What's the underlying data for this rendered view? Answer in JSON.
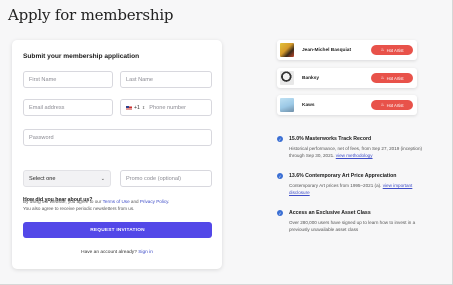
{
  "page_title": "Apply for membership",
  "form": {
    "title": "Submit your membership application",
    "first_name_placeholder": "First Name",
    "last_name_placeholder": "Last Name",
    "email_placeholder": "Email address",
    "phone_country_code": "+1",
    "phone_placeholder": "Phone number",
    "password_placeholder": "Password",
    "referral_question": "How did you hear about us?",
    "referral_selected": "Select one",
    "promo_placeholder": "Promo code (optional)",
    "legal_prefix": "By using our website, you agree to our ",
    "terms_link": "Terms of Use",
    "legal_and": " and ",
    "privacy_link": "Privacy Policy",
    "legal_suffix": ".",
    "newsletter_text": "You also agree to receive periodic newsletters from us.",
    "submit_label": "REQUEST INVITATION",
    "signin_prompt": "Have an account already? ",
    "signin_link": "Sign in"
  },
  "artists": [
    {
      "name": "Jean-Michel Basquiat",
      "badge": "Hot Artist"
    },
    {
      "name": "Banksy",
      "badge": "Hot Artist"
    },
    {
      "name": "Kaws",
      "badge": "Hot Artist"
    }
  ],
  "features": [
    {
      "title": "15.0% Masterworks Track Record",
      "desc": "Historical performance, net of fees, from Sep 27, 2019 (inception) through Sep 30, 2021.",
      "link": "view methodology"
    },
    {
      "title": "13.6% Contemporary Art Price Appreciation",
      "desc": "Contemporary Art prices from 1995–2021 (a).",
      "link": "view important disclosure"
    },
    {
      "title": "Access an Exclusive Asset Class",
      "desc": "Over 280,000 users have signed up to learn how to invest in a previously unavailable asset class",
      "link": ""
    }
  ],
  "colors": {
    "accent": "#5348e8",
    "hot_badge": "#e8524a",
    "check": "#3b6fd4",
    "link": "#3d4cc8"
  }
}
